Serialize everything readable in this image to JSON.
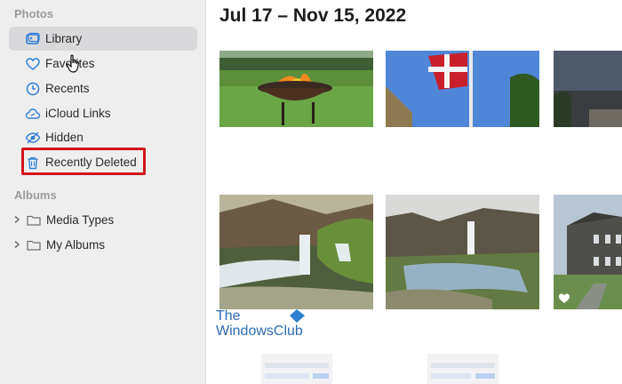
{
  "sidebar": {
    "photos_header": "Photos",
    "items": [
      {
        "label": "Library",
        "icon": "photo-library-icon"
      },
      {
        "label": "Favorites",
        "icon": "heart-icon"
      },
      {
        "label": "Recents",
        "icon": "clock-icon"
      },
      {
        "label": "iCloud Links",
        "icon": "cloud-link-icon"
      },
      {
        "label": "Hidden",
        "icon": "eye-slash-icon"
      },
      {
        "label": "Recently Deleted",
        "icon": "trash-icon"
      }
    ],
    "albums_header": "Albums",
    "albums": [
      {
        "label": "Media Types",
        "icon": "folder-icon"
      },
      {
        "label": "My Albums",
        "icon": "folder-icon"
      }
    ]
  },
  "main": {
    "date_range": "Jul 17 – Nov 15, 2022"
  },
  "watermark": {
    "line1": "The",
    "line2": "WindowsClub"
  },
  "colors": {
    "accent": "#2f7ed8",
    "highlight_box": "#d4131b",
    "sidebar_bg": "#eeeeef",
    "watermark": "#2d6ab3"
  }
}
